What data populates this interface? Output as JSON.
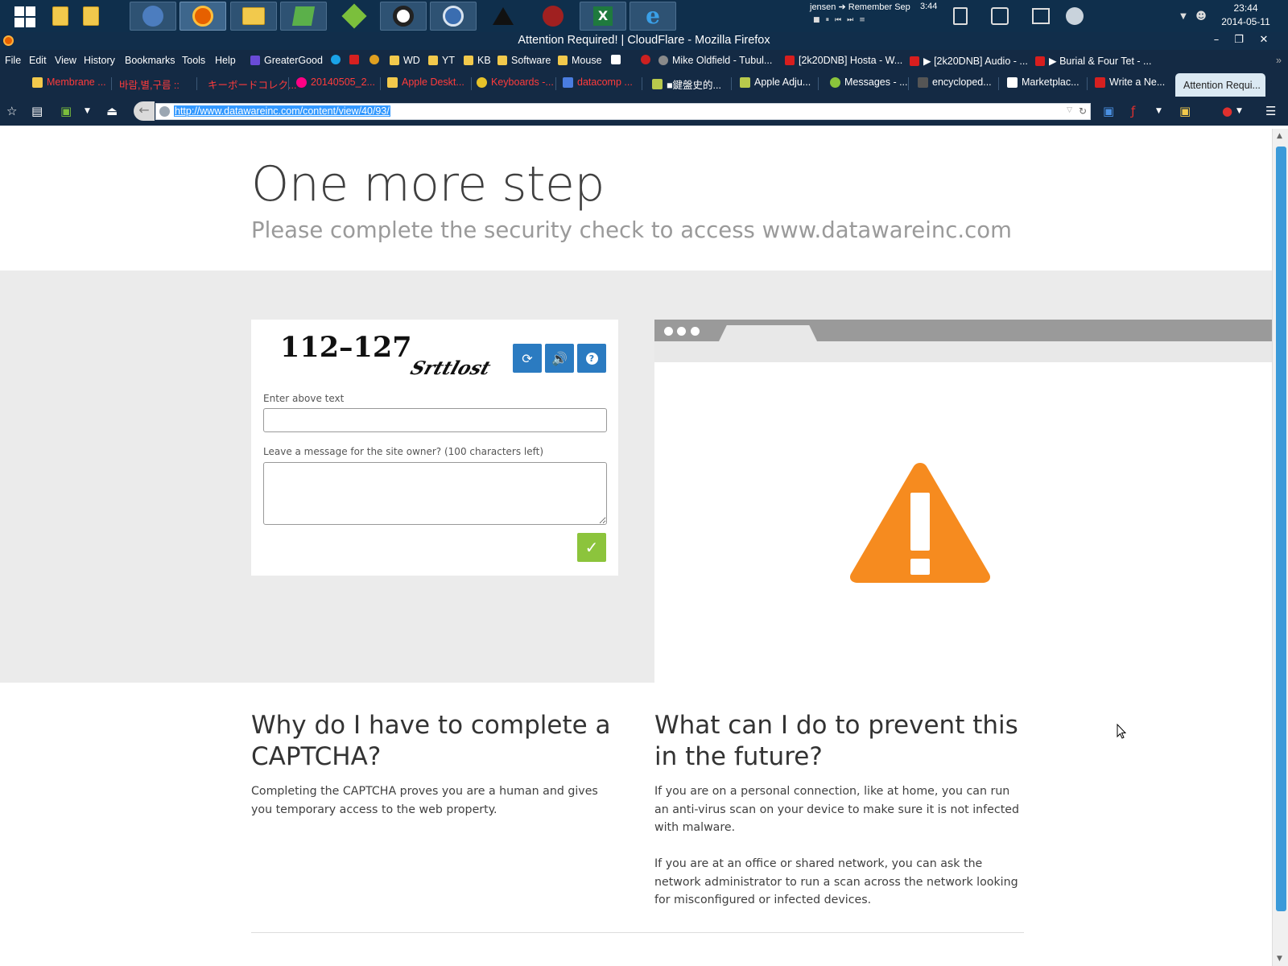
{
  "taskbar": {
    "media": {
      "track": "jensen ➔ Remember Sep",
      "time": "3:44"
    },
    "clock": {
      "time": "23:44",
      "date": "2014-05-11"
    }
  },
  "window": {
    "title": "Attention Required! | CloudFlare - Mozilla Firefox"
  },
  "menu": {
    "items": [
      "File",
      "Edit",
      "View",
      "History",
      "Bookmarks",
      "Tools",
      "Help"
    ]
  },
  "bookmarks": [
    {
      "label": "GreaterGood",
      "color": "#6a4bd8"
    },
    {
      "label": "",
      "color": "#1aa3e8"
    },
    {
      "label": "",
      "color": "#d62020"
    },
    {
      "label": "",
      "color": "#e0a020"
    },
    {
      "label": "WD",
      "color": "#f2c94c"
    },
    {
      "label": "YT",
      "color": "#f2c94c"
    },
    {
      "label": "KB",
      "color": "#f2c94c"
    },
    {
      "label": "Software",
      "color": "#f2c94c"
    },
    {
      "label": "Mouse",
      "color": "#f2c94c"
    },
    {
      "label": "",
      "color": "#ffffff"
    },
    {
      "label": "",
      "color": "#cc2020"
    },
    {
      "label": "Mike Oldfield - Tubul...",
      "color": "#8a8a8a"
    },
    {
      "label": "[2k20DNB] Hosta - W...",
      "color": "#d81e1e"
    },
    {
      "label": "▶ [2k20DNB] Audio - ...",
      "color": "#d81e1e"
    },
    {
      "label": "▶ Burial & Four Tet - ...",
      "color": "#d81e1e"
    }
  ],
  "tabs": [
    {
      "label": "Membrane ...",
      "color": "#f2c94c",
      "style": "red"
    },
    {
      "label": "바람,별,구름 ::",
      "color": "",
      "style": "red"
    },
    {
      "label": "キーボードコレク...",
      "color": "",
      "style": "red"
    },
    {
      "label": "20140505_2...",
      "color": "#ff0084",
      "style": "red"
    },
    {
      "label": "Apple Deskt...",
      "color": "#f2c94c",
      "style": "red"
    },
    {
      "label": "Keyboards -...",
      "color": "#e6c229",
      "style": "red"
    },
    {
      "label": "datacomp ...",
      "color": "#4a7de0",
      "style": "red"
    },
    {
      "label": "■鍵盤史的...",
      "color": "#b8c94c",
      "style": "white"
    },
    {
      "label": "Apple Adju...",
      "color": "#b8c94c",
      "style": "white"
    },
    {
      "label": "Messages - ...",
      "color": "#8ac43c",
      "style": "white"
    },
    {
      "label": "encycloped...",
      "color": "#555555",
      "style": "white"
    },
    {
      "label": "Marketplac...",
      "color": "#ffffff",
      "style": "white"
    },
    {
      "label": "Write a Ne...",
      "color": "#d62020",
      "style": "white"
    }
  ],
  "active_tab": "Attention Requi...",
  "address_bar": {
    "url": "http://www.datawareinc.com/content/view/40/93/"
  },
  "page": {
    "heading": "One more step",
    "subheading": "Please complete the security check to access www.datawareinc.com",
    "captcha": {
      "image_text_1": "112–127",
      "image_text_2": "Srttlost",
      "input_label": "Enter above text",
      "input_value": "",
      "message_label": "Leave a message for the site owner? (100 characters left)",
      "message_value": "",
      "buttons": [
        "refresh-icon",
        "audio-icon",
        "help-icon"
      ],
      "submit_icon": "✓"
    },
    "why": {
      "title": "Why do I have to complete a CAPTCHA?",
      "body": "Completing the CAPTCHA proves you are a human and gives you temporary access to the web property."
    },
    "prevent": {
      "title": "What can I do to prevent this in the future?",
      "body_1": "If you are on a personal connection, like at home, you can run an anti-virus scan on your device to make sure it is not infected with malware.",
      "body_2": "If you are at an office or shared network, you can ask the network administrator to run a scan across the network looking for misconfigured or infected devices."
    }
  },
  "colors": {
    "accent_blue": "#2b7bc1",
    "submit_green": "#8cc43c",
    "warning_orange": "#f68b1f",
    "band_gray": "#ebebeb"
  }
}
